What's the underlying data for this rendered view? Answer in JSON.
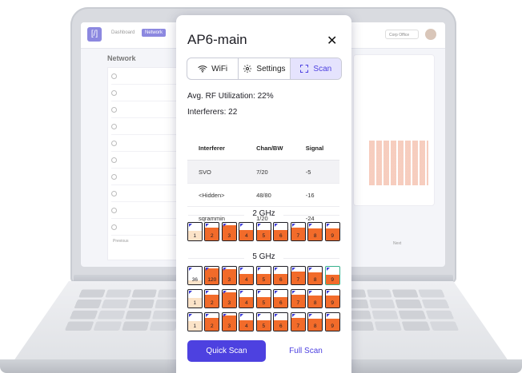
{
  "modal": {
    "title": "AP6-main",
    "tabs": [
      {
        "label": "WiFi",
        "icon": "wifi-icon"
      },
      {
        "label": "Settings",
        "icon": "gear-icon"
      },
      {
        "label": "Scan",
        "icon": "scan-icon",
        "active": true
      }
    ],
    "avg_rf": "Avg. RF Utilization: 22%",
    "interferers_count": "Interferers: 22",
    "table": {
      "headers": [
        "Interferer",
        "Chan/BW",
        "Signal"
      ],
      "rows": [
        [
          "SVO",
          "7/20",
          "-5"
        ],
        [
          "<Hidden>",
          "48/80",
          "-16"
        ],
        [
          "sqrammin",
          "1/20",
          "-24"
        ]
      ]
    },
    "band_24_label": "2 GHz",
    "band_5_label": "5 GHz",
    "rows_24": [
      {
        "labels": [
          "1",
          "2",
          "3",
          "4",
          "5",
          "6",
          "7",
          "8",
          "9"
        ],
        "fill": [
          0.55,
          0.75,
          0.85,
          0.6,
          0.6,
          0.6,
          0.75,
          0.7,
          0.7
        ]
      }
    ],
    "rows_5": [
      {
        "labels": [
          "36",
          "120",
          "3",
          "4",
          "5",
          "6",
          "7",
          "8",
          "9"
        ],
        "fill": [
          0.25,
          0.9,
          0.85,
          0.6,
          0.6,
          0.6,
          0.75,
          0.7,
          0.55
        ]
      },
      {
        "labels": [
          "1",
          "2",
          "3",
          "4",
          "5",
          "6",
          "7",
          "8",
          "9"
        ],
        "fill": [
          0.55,
          0.75,
          0.85,
          0.6,
          0.6,
          0.6,
          0.75,
          0.7,
          0.7
        ]
      },
      {
        "labels": [
          "1",
          "2",
          "3",
          "4",
          "5",
          "6",
          "7",
          "8",
          "9"
        ],
        "fill": [
          0.55,
          0.75,
          0.85,
          0.6,
          0.6,
          0.6,
          0.75,
          0.7,
          0.7
        ]
      }
    ],
    "quick_scan_label": "Quick Scan",
    "full_scan_label": "Full Scan"
  },
  "background": {
    "page_title": "Network",
    "nav_dashboard": "Dashboard",
    "nav_network": "Network",
    "office_select": "Corp Office",
    "previous_label": "Previous",
    "next_label": "Next"
  },
  "colors": {
    "accent": "#4d41e0",
    "accent_light": "#e5e3fd",
    "channel_fill": "#f26b2a",
    "channel_low": "#fbe3c8",
    "highlight": "#35b08c"
  }
}
